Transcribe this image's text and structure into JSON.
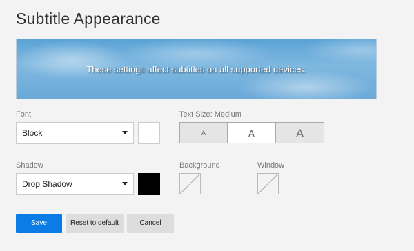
{
  "page": {
    "title": "Subtitle Appearance"
  },
  "preview": {
    "text": "These settings affect subtitles on all supported devices."
  },
  "font": {
    "label": "Font",
    "value": "Block",
    "color": "#ffffff"
  },
  "text_size": {
    "label": "Text Size: Medium",
    "options": [
      "A",
      "A",
      "A"
    ],
    "selected": "Medium"
  },
  "shadow": {
    "label": "Shadow",
    "value": "Drop Shadow",
    "color": "#000000"
  },
  "background": {
    "label": "Background",
    "color": "none"
  },
  "window": {
    "label": "Window",
    "color": "none"
  },
  "buttons": {
    "save": "Save",
    "reset": "Reset to default",
    "cancel": "Cancel"
  },
  "colors": {
    "accent": "#0b7ce6"
  }
}
